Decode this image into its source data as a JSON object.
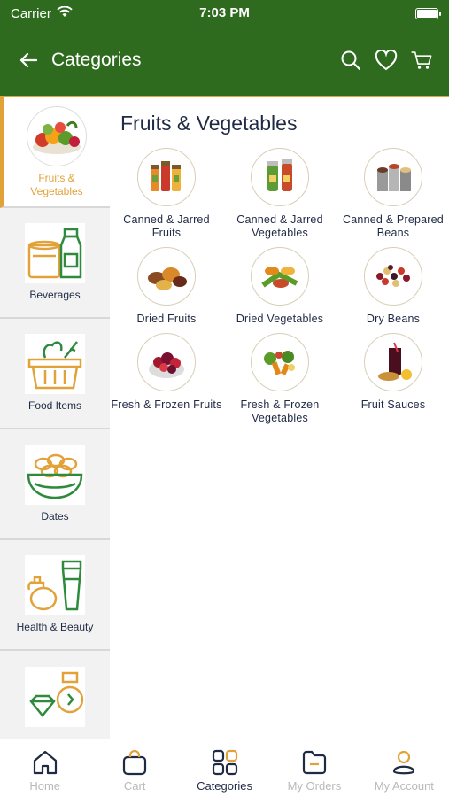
{
  "status": {
    "carrier": "Carrier",
    "time": "7:03 PM"
  },
  "header": {
    "title": "Categories"
  },
  "sidebar": {
    "items": [
      {
        "label": "Fruits & Vegetables",
        "icon": "fruits-vegetables-icon",
        "active": true
      },
      {
        "label": "Beverages",
        "icon": "beverages-icon"
      },
      {
        "label": "Food Items",
        "icon": "food-basket-icon"
      },
      {
        "label": "Dates",
        "icon": "dates-bowl-icon"
      },
      {
        "label": "Health & Beauty",
        "icon": "health-beauty-icon"
      },
      {
        "label": "",
        "icon": "jewelry-watch-icon"
      }
    ]
  },
  "main": {
    "section_title": "Fruits & Vegetables",
    "items": [
      {
        "label": "Canned & Jarred Fruits"
      },
      {
        "label": "Canned & Jarred Vegetables"
      },
      {
        "label": "Canned & Prepared Beans"
      },
      {
        "label": "Dried Fruits"
      },
      {
        "label": "Dried Vegetables"
      },
      {
        "label": "Dry Beans"
      },
      {
        "label": "Fresh & Frozen Fruits"
      },
      {
        "label": "Fresh & Frozen Vegetables"
      },
      {
        "label": "Fruit Sauces"
      }
    ]
  },
  "tabbar": {
    "tabs": [
      {
        "label": "Home"
      },
      {
        "label": "Cart"
      },
      {
        "label": "Categories"
      },
      {
        "label": "My Orders"
      },
      {
        "label": "My Account"
      }
    ]
  },
  "colors": {
    "header_green": "#2f6b1f",
    "accent_orange": "#e2a23a",
    "text_navy": "#1f2a44"
  }
}
